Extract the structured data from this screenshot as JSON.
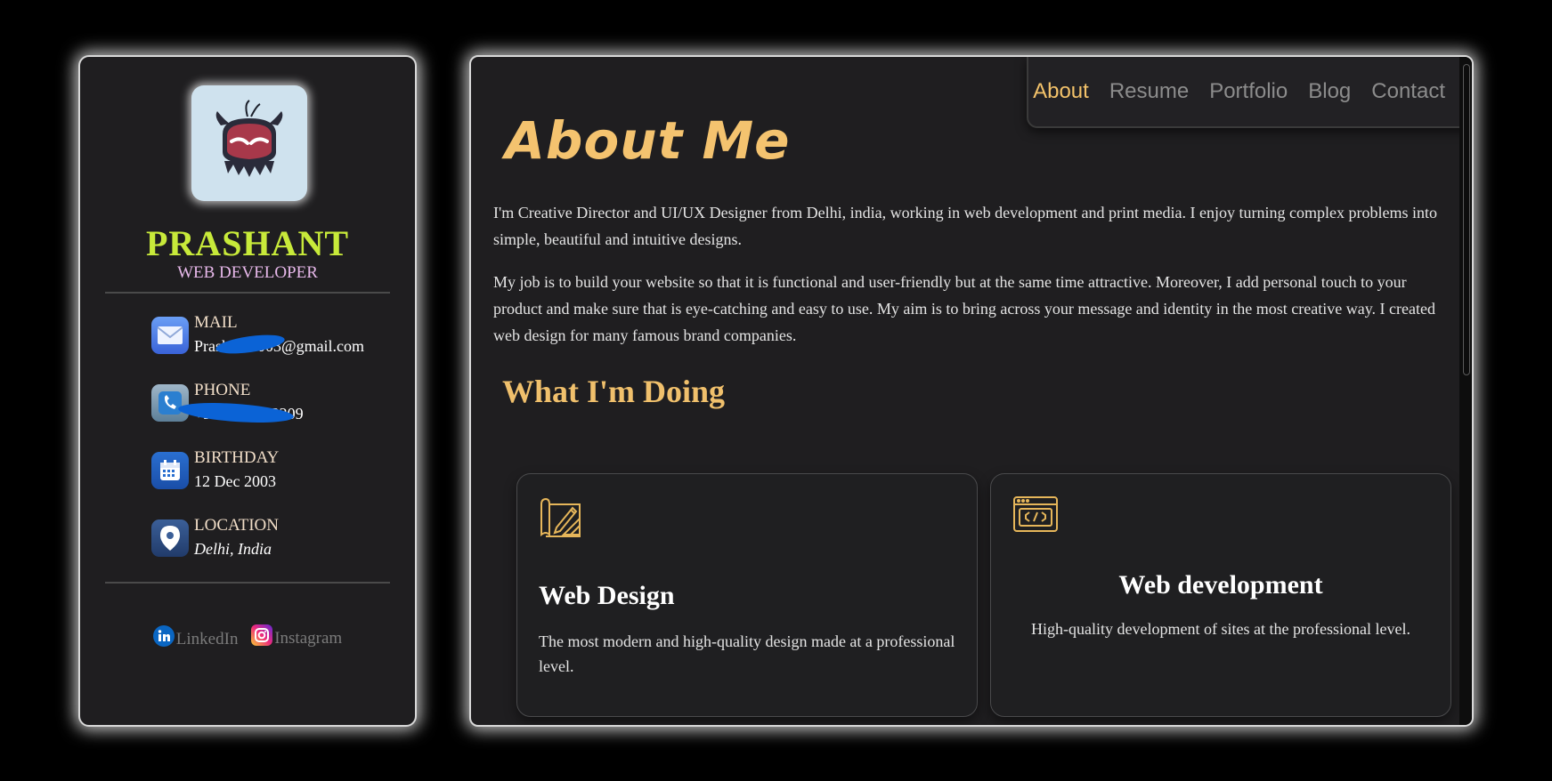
{
  "profile": {
    "name": "PRASHANT",
    "title": "WEB DEVELOPER",
    "avatar_icon": "monster-avatar-icon"
  },
  "contacts": [
    {
      "label": "MAIL",
      "value": "Prashant2003@gmail.com",
      "icon": "mail-icon"
    },
    {
      "label": "PHONE",
      "value": "+91 9876543209",
      "icon": "phone-icon"
    },
    {
      "label": "BIRTHDAY",
      "value": "12 Dec 2003",
      "icon": "calendar-icon"
    },
    {
      "label": "LOCATION",
      "value": "Delhi, India",
      "icon": "location-pin-icon"
    }
  ],
  "socials": [
    {
      "label": "LinkedIn",
      "icon": "linkedin-icon"
    },
    {
      "label": "Instagram",
      "icon": "instagram-icon"
    }
  ],
  "nav": {
    "items": [
      "About",
      "Resume",
      "Portfolio",
      "Blog",
      "Contact"
    ],
    "active": "About"
  },
  "about": {
    "title": "About Me",
    "paragraphs": [
      "I'm Creative Director and UI/UX Designer from Delhi, india, working in web development and print media. I enjoy turning complex problems into simple, beautiful and intuitive designs.",
      "My job is to build your website so that it is functional and user-friendly but at the same time attractive. Moreover, I add personal touch to your product and make sure that is eye-catching and easy to use. My aim is to bring across your message and identity in the most creative way. I created web design for many famous brand companies."
    ]
  },
  "doing": {
    "title": "What I'm Doing",
    "services": [
      {
        "title": "Web Design",
        "text": "The most modern and high-quality design made at a professional level.",
        "icon": "design-tools-icon"
      },
      {
        "title": "Web development",
        "text": "High-quality development of sites at the professional level.",
        "icon": "code-window-icon"
      }
    ]
  },
  "colors": {
    "accent": "#f4c36f",
    "name": "#c8ea3a",
    "subtitle": "#e7b8ea",
    "panel": "#1f1e20"
  }
}
